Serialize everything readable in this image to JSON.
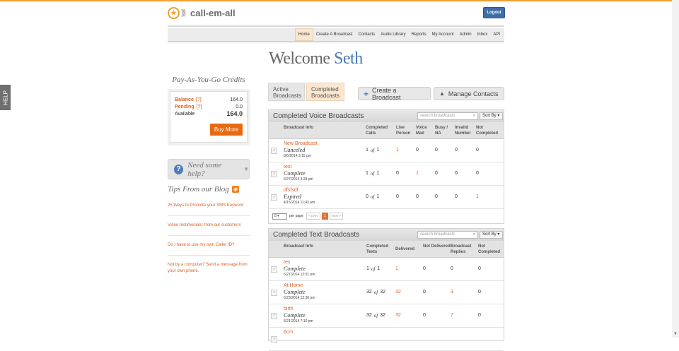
{
  "help_tab": "HELP",
  "logo": {
    "icon": "★",
    "waves": ")))",
    "name": "call-em-all"
  },
  "logout_label": "Logout",
  "nav": [
    "Home",
    "Create A Broadcast",
    "Contacts",
    "Audio Library",
    "Reports",
    "My Account",
    "Admin",
    "Inbox",
    "API"
  ],
  "welcome": {
    "prefix": "Welcome ",
    "user": "Seth"
  },
  "sidebar": {
    "credits_title": "Pay-As-You-Go Credits",
    "balance_label": "Balance",
    "balance_q": "[?]",
    "balance_value": "164.0",
    "pending_label": "Pending",
    "pending_q": "[?]",
    "pending_value": "0.0",
    "available_label": "Available",
    "available_value": "164.0",
    "buy_more": "Buy More",
    "help_text": "Need some help?",
    "tips_title": "Tips From our Blog",
    "tips": [
      "25 Ways to Promote your SMS Keyword",
      "Video testimonials: from our customers",
      "Do I have to use my own Caller ID?",
      "Not by a computer? Send a message from your own phone."
    ]
  },
  "tabs": {
    "active_broadcasts": "Active Broadcasts",
    "completed_broadcasts": "Completed Broadcasts"
  },
  "actions": {
    "create": "Create a Broadcast",
    "manage": "Manage Contacts"
  },
  "voice": {
    "title": "Completed Voice Broadcasts",
    "search_placeholder": "search broadcasts",
    "sort_label": "Sort By",
    "columns": [
      "Broadcast Info",
      "Completed Calls",
      "Live Person",
      "Voice Mail",
      "Busy / NA",
      "Invalid Number",
      "Not Completed"
    ],
    "rows": [
      {
        "name": "New Broadcast",
        "status": "Canceled",
        "date": "8/6/2014 3:15 pm",
        "completed_a": "1",
        "completed_b": "1",
        "live": "1",
        "vm": "0",
        "busy": "0",
        "invalid": "0",
        "not_completed": "0"
      },
      {
        "name": "test",
        "status": "Complete",
        "date": "6/27/2014 3:28 pm",
        "completed_a": "1",
        "completed_b": "1",
        "live": "0",
        "vm": "1",
        "busy": "0",
        "invalid": "0",
        "not_completed": "0"
      },
      {
        "name": "dfsfsdf",
        "status": "Expired",
        "date": "4/15/2014 11:43 am",
        "completed_a": "0",
        "completed_b": "1",
        "live": "0",
        "vm": "0",
        "busy": "0",
        "invalid": "0",
        "not_completed": "1"
      }
    ],
    "pager": {
      "per_page_value": "5",
      "per_page_label": "per page",
      "prev": "< prev",
      "current": "1",
      "next": "next >"
    }
  },
  "text": {
    "title": "Completed Text Broadcasts",
    "search_placeholder": "search broadcasts",
    "sort_label": "Sort By",
    "columns": [
      "Broadcast Info",
      "Completed Texts",
      "Delivered",
      "Not Delivered",
      "Broadcast Replies",
      "Not Completed"
    ],
    "rows": [
      {
        "name": "tes",
        "status": "Complete",
        "date": "6/27/2014 12:01 pm",
        "completed_a": "1",
        "completed_b": "1",
        "delivered": "1",
        "not_delivered": "0",
        "replies": "0",
        "not_completed": "0"
      },
      {
        "name": "At Home",
        "status": "Complete",
        "date": "5/23/2014 12:36 pm",
        "completed_a": "32",
        "completed_b": "32",
        "delivered": "32",
        "not_delivered": "0",
        "replies": "3",
        "not_completed": "0"
      },
      {
        "name": "birth",
        "status": "Complete",
        "date": "5/21/2014 7:10 pm",
        "completed_a": "32",
        "completed_b": "32",
        "delivered": "32",
        "not_delivered": "0",
        "replies": "7",
        "not_completed": "0"
      },
      {
        "name": "6cm",
        "status": "",
        "date": "",
        "completed_a": "",
        "completed_b": "",
        "delivered": "",
        "not_delivered": "",
        "replies": "",
        "not_completed": ""
      }
    ]
  },
  "of_word": "of"
}
